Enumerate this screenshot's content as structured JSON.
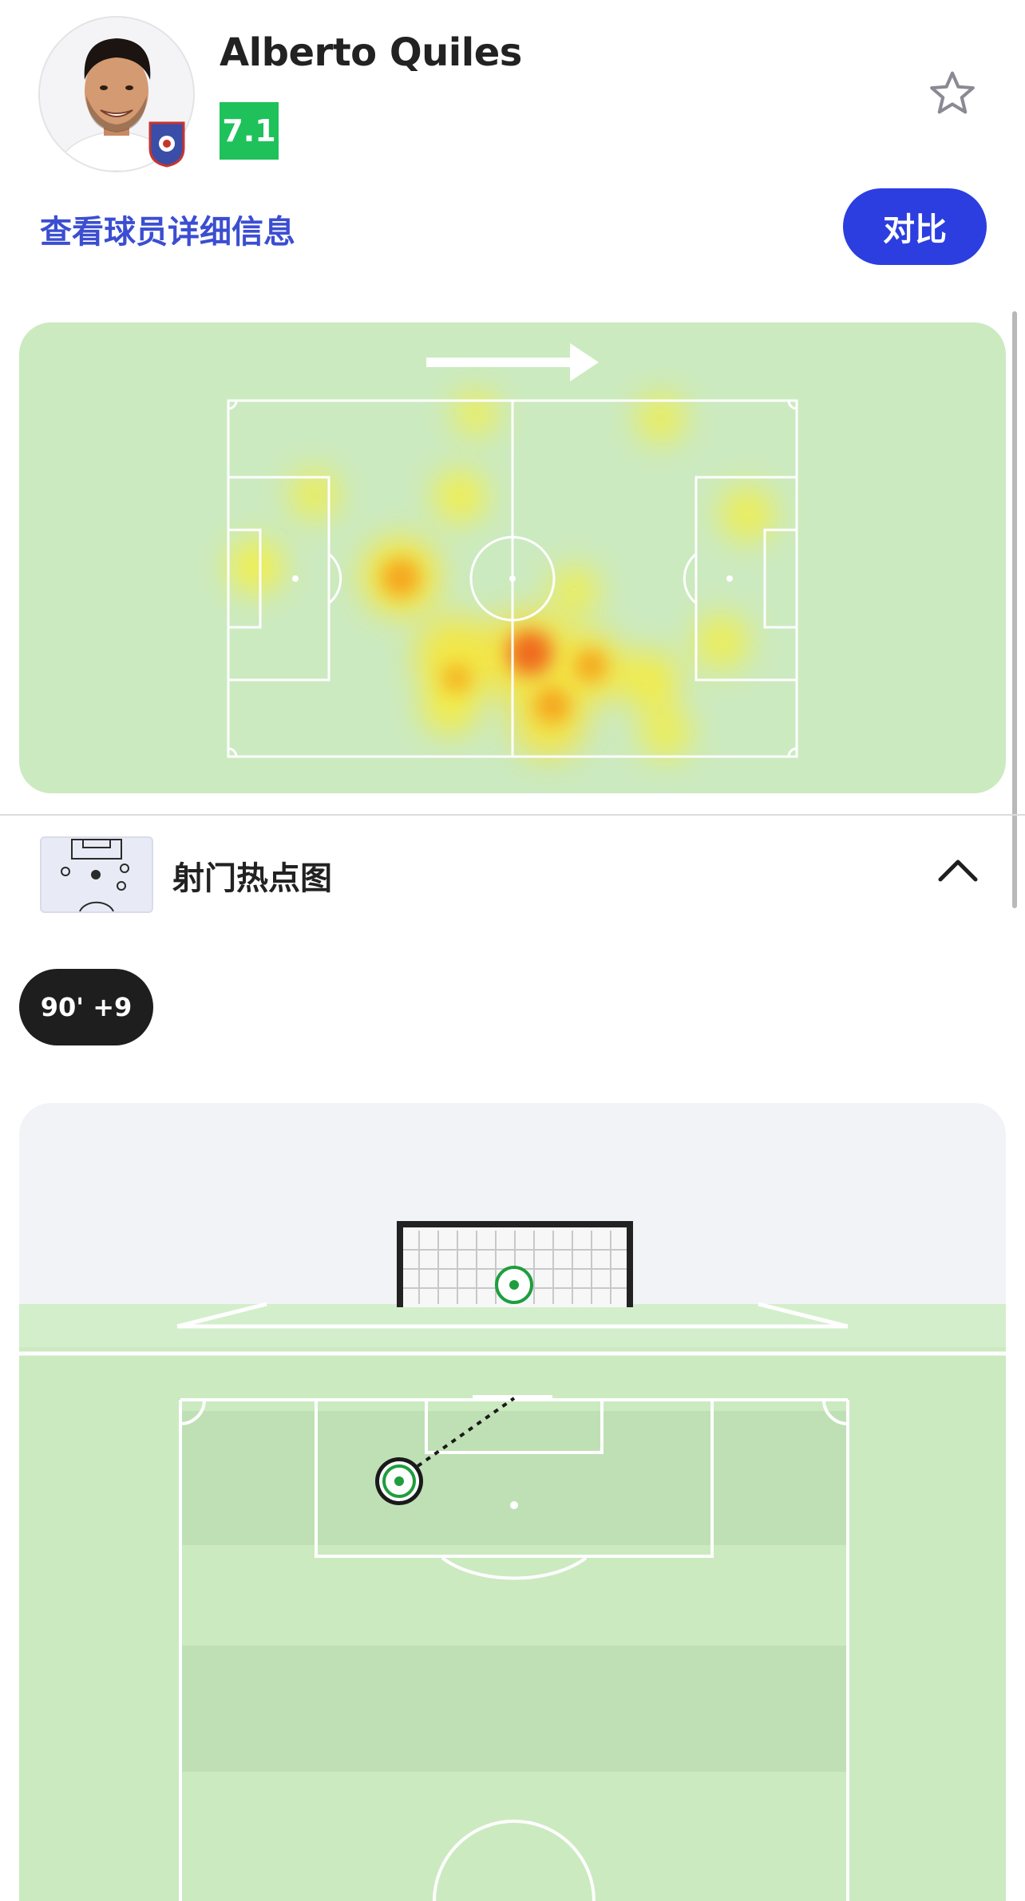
{
  "player": {
    "name": "Alberto Quiles",
    "rating": "7.1",
    "details_link": "查看球员详细信息",
    "compare_label": "对比"
  },
  "heatmap": {
    "direction": "attacking-right"
  },
  "shot_map": {
    "title": "射门热点图",
    "time_filter": "90' +9",
    "shots": [
      {
        "result": "on-target"
      }
    ]
  },
  "colors": {
    "accent": "#2c3ee0",
    "link": "#3b4ed1",
    "rating": "#1fc15b",
    "pitch": "#cbeac0",
    "shot_marker": "#1e9e3e"
  }
}
